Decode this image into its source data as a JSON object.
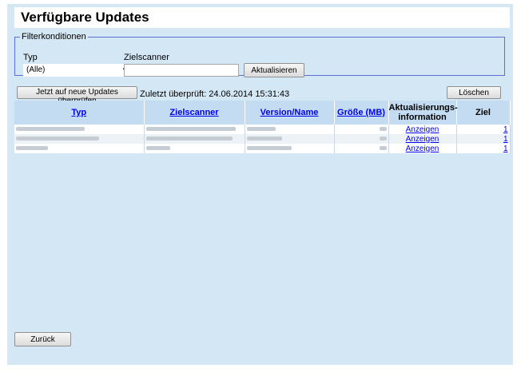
{
  "title": "Verfügbare Updates",
  "filter": {
    "legend": "Filterkonditionen",
    "typ_label": "Typ",
    "zielscanner_label": "Zielscanner",
    "typ_selected": "(Alle)",
    "zielscanner_value": "",
    "refresh_button": "Aktualisieren"
  },
  "toolbar": {
    "check_button": "Jetzt auf neue Updates überprüfen",
    "last_checked": "Zuletzt überprüft: 24.06.2014 15:31:43",
    "delete_button": "Löschen"
  },
  "table": {
    "columns": {
      "typ": "Typ",
      "zielscanner": "Zielscanner",
      "version": "Version/Name",
      "groesse": "Größe (MB)",
      "info_line1": "Aktualisierungs-",
      "info_line2": "information",
      "ziel": "Ziel"
    },
    "rows": [
      {
        "info": "Anzeigen",
        "ziel": "1"
      },
      {
        "info": "Anzeigen",
        "ziel": "1"
      },
      {
        "info": "Anzeigen",
        "ziel": "1"
      }
    ]
  },
  "back_button": "Zurück"
}
